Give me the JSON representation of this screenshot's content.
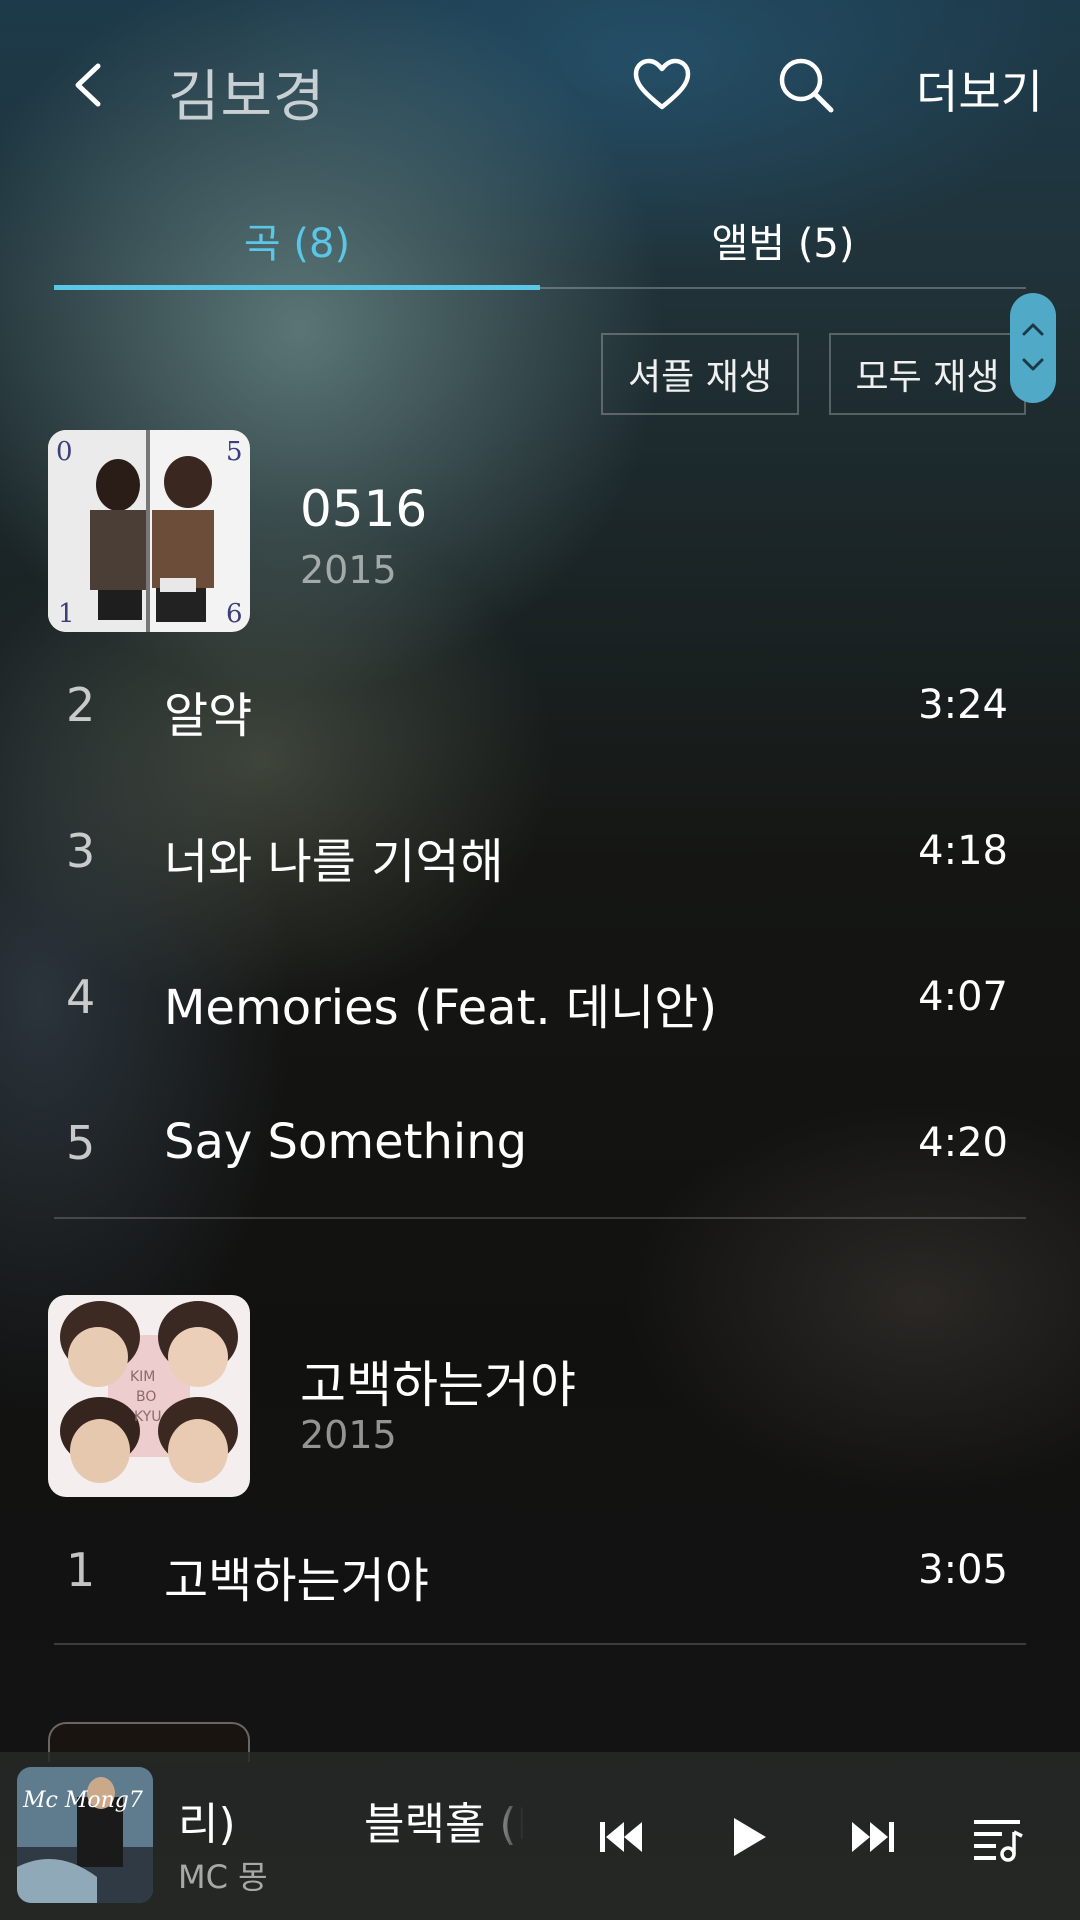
{
  "header": {
    "title": "김보경",
    "more_label": "더보기"
  },
  "tabs": [
    {
      "label": "곡 (8)",
      "active": true
    },
    {
      "label": "앨범 (5)",
      "active": false
    }
  ],
  "actions": {
    "shuffle_label": "셔플 재생",
    "play_all_label": "모두 재생"
  },
  "albums": [
    {
      "title": "0516",
      "year": "2015",
      "tracks": [
        {
          "num": "2",
          "title": "알약",
          "duration": "3:24"
        },
        {
          "num": "3",
          "title": "너와 나를 기억해",
          "duration": "4:18"
        },
        {
          "num": "4",
          "title": "Memories (Feat. 데니안)",
          "duration": "4:07"
        },
        {
          "num": "5",
          "title": "Say Something",
          "duration": "4:20"
        }
      ]
    },
    {
      "title": "고백하는거야",
      "year": "2015",
      "tracks": [
        {
          "num": "1",
          "title": "고백하는거야",
          "duration": "3:05"
        }
      ]
    }
  ],
  "mini_player": {
    "title_part1": "리)",
    "title_part2": "블랙홀 (F",
    "artist": "MC 몽"
  },
  "colors": {
    "accent": "#5bc6e6",
    "scroll_handle": "#4fa9c7"
  }
}
